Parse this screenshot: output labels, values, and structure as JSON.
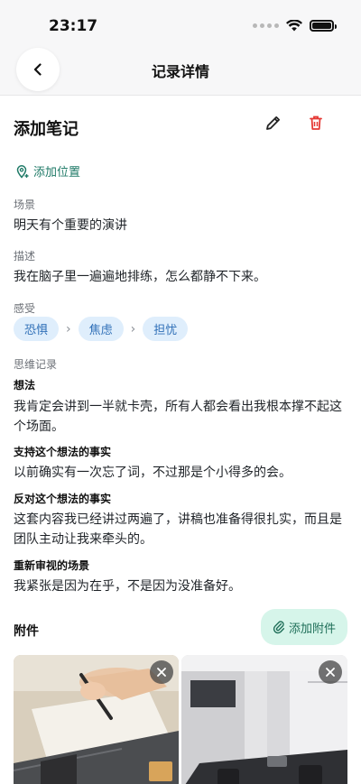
{
  "status": {
    "time": "23:17"
  },
  "nav": {
    "title": "记录详情"
  },
  "record": {
    "title": "添加笔记"
  },
  "location": {
    "label": "添加位置"
  },
  "scene": {
    "label": "场景",
    "value": "明天有个重要的演讲"
  },
  "description": {
    "label": "描述",
    "value": "我在脑子里一遍遍地排练，怎么都静不下来。"
  },
  "feelings": {
    "label": "感受",
    "items": [
      "恐惧",
      "焦虑",
      "担忧"
    ]
  },
  "thinking": {
    "label": "思维记录",
    "sections": [
      {
        "label": "想法",
        "value": "我肯定会讲到一半就卡壳，所有人都会看出我根本撑不起这个场面。"
      },
      {
        "label": "支持这个想法的事实",
        "value": "以前确实有一次忘了词，不过那是个小得多的会。"
      },
      {
        "label": "反对这个想法的事实",
        "value": "这套内容我已经讲过两遍了，讲稿也准备得很扎实，而且是团队主动让我来牵头的。"
      },
      {
        "label": "重新审视的场景",
        "value": "我紧张是因为在乎，不是因为没准备好。"
      }
    ]
  },
  "attachments": {
    "label": "附件",
    "add_label": "添加附件"
  },
  "colors": {
    "accent_green": "#1f7a67",
    "delete_red": "#e53935",
    "chip_blue": "#2f6fb7"
  }
}
